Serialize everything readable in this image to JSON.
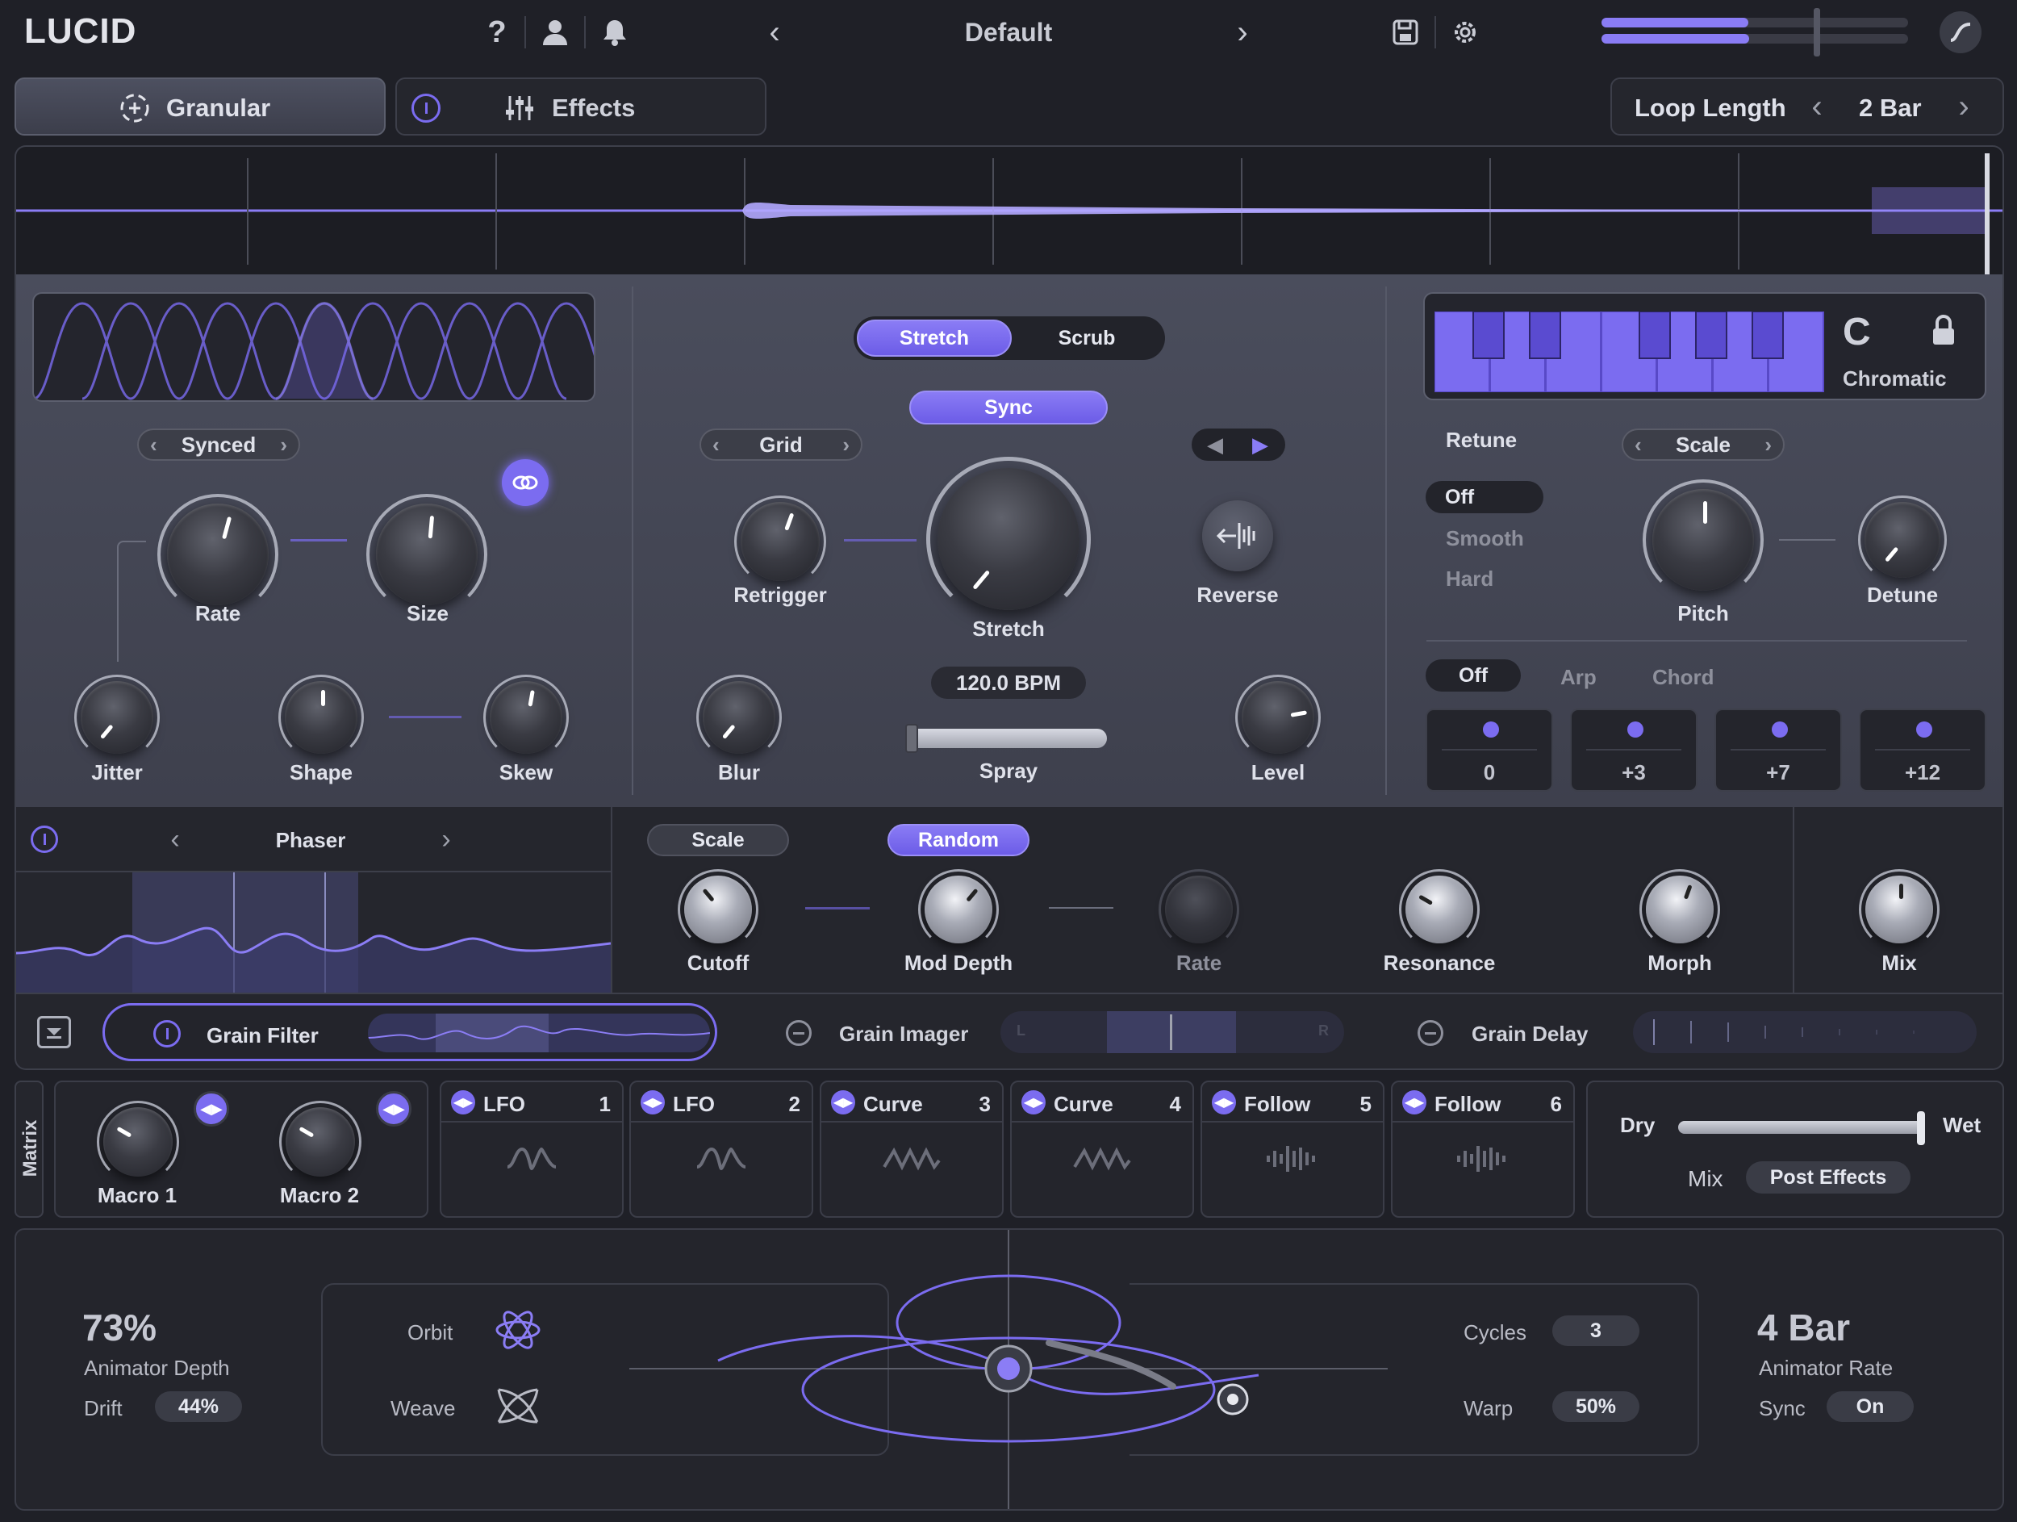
{
  "header": {
    "logo": "LUCID",
    "preset": "Default"
  },
  "tabs": {
    "granular": "Granular",
    "effects": "Effects"
  },
  "loop": {
    "label": "Loop Length",
    "value": "2 Bar"
  },
  "grain": {
    "mode": "Synced",
    "rate": "Rate",
    "size": "Size",
    "jitter": "Jitter",
    "shape": "Shape",
    "skew": "Skew"
  },
  "stretch": {
    "mode_stretch": "Stretch",
    "mode_scrub": "Scrub",
    "sync": "Sync",
    "grid": "Grid",
    "retrigger": "Retrigger",
    "stretch_knob": "Stretch",
    "reverse": "Reverse",
    "bpm": "120.0 BPM",
    "spray": "Spray",
    "blur": "Blur",
    "level": "Level"
  },
  "pitch": {
    "key": "C",
    "scale_name": "Chromatic",
    "retune": "Retune",
    "retune_off": "Off",
    "retune_smooth": "Smooth",
    "retune_hard": "Hard",
    "scale_sel": "Scale",
    "pitch": "Pitch",
    "detune": "Detune",
    "mode_off": "Off",
    "mode_arp": "Arp",
    "mode_chord": "Chord",
    "notes": [
      "0",
      "+3",
      "+7",
      "+12"
    ]
  },
  "fx": {
    "name": "Phaser",
    "scale": "Scale",
    "random": "Random",
    "cutoff": "Cutoff",
    "mod_depth": "Mod Depth",
    "rate": "Rate",
    "resonance": "Resonance",
    "morph": "Morph",
    "mix": "Mix"
  },
  "chain": {
    "filter": "Grain Filter",
    "imager": "Grain Imager",
    "delay": "Grain Delay",
    "imager_l": "L",
    "imager_r": "R"
  },
  "matrix": {
    "label": "Matrix",
    "macro1": "Macro 1",
    "macro2": "Macro 2",
    "slots": [
      {
        "name": "LFO",
        "no": "1"
      },
      {
        "name": "LFO",
        "no": "2"
      },
      {
        "name": "Curve",
        "no": "3"
      },
      {
        "name": "Curve",
        "no": "4"
      },
      {
        "name": "Follow",
        "no": "5"
      },
      {
        "name": "Follow",
        "no": "6"
      }
    ]
  },
  "mix": {
    "dry": "Dry",
    "wet": "Wet",
    "mix": "Mix",
    "post": "Post Effects"
  },
  "animator": {
    "depth_value": "73%",
    "depth_label": "Animator Depth",
    "drift": "Drift",
    "drift_value": "44%",
    "orbit": "Orbit",
    "weave": "Weave",
    "cycles": "Cycles",
    "cycles_value": "3",
    "warp": "Warp",
    "warp_value": "50%",
    "rate_value": "4 Bar",
    "rate_label": "Animator Rate",
    "sync": "Sync",
    "sync_value": "On"
  }
}
